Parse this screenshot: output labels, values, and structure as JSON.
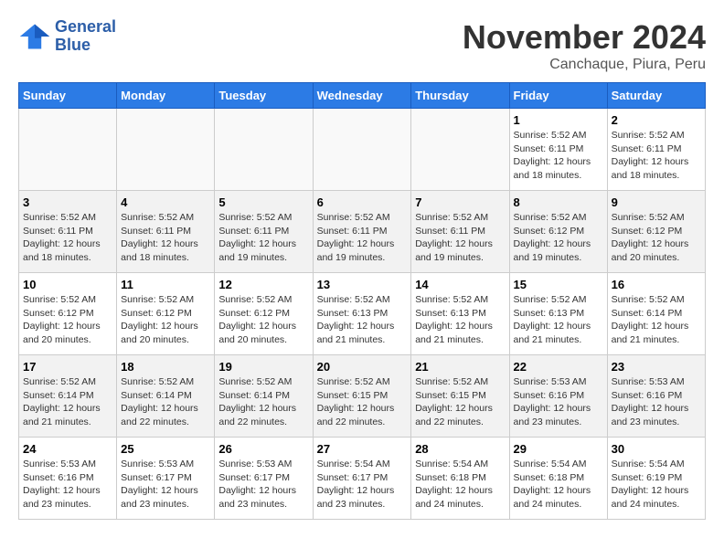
{
  "header": {
    "logo_line1": "General",
    "logo_line2": "Blue",
    "month": "November 2024",
    "location": "Canchaque, Piura, Peru"
  },
  "days_of_week": [
    "Sunday",
    "Monday",
    "Tuesday",
    "Wednesday",
    "Thursday",
    "Friday",
    "Saturday"
  ],
  "weeks": [
    [
      {
        "day": "",
        "info": ""
      },
      {
        "day": "",
        "info": ""
      },
      {
        "day": "",
        "info": ""
      },
      {
        "day": "",
        "info": ""
      },
      {
        "day": "",
        "info": ""
      },
      {
        "day": "1",
        "info": "Sunrise: 5:52 AM\nSunset: 6:11 PM\nDaylight: 12 hours and 18 minutes."
      },
      {
        "day": "2",
        "info": "Sunrise: 5:52 AM\nSunset: 6:11 PM\nDaylight: 12 hours and 18 minutes."
      }
    ],
    [
      {
        "day": "3",
        "info": "Sunrise: 5:52 AM\nSunset: 6:11 PM\nDaylight: 12 hours and 18 minutes."
      },
      {
        "day": "4",
        "info": "Sunrise: 5:52 AM\nSunset: 6:11 PM\nDaylight: 12 hours and 18 minutes."
      },
      {
        "day": "5",
        "info": "Sunrise: 5:52 AM\nSunset: 6:11 PM\nDaylight: 12 hours and 19 minutes."
      },
      {
        "day": "6",
        "info": "Sunrise: 5:52 AM\nSunset: 6:11 PM\nDaylight: 12 hours and 19 minutes."
      },
      {
        "day": "7",
        "info": "Sunrise: 5:52 AM\nSunset: 6:11 PM\nDaylight: 12 hours and 19 minutes."
      },
      {
        "day": "8",
        "info": "Sunrise: 5:52 AM\nSunset: 6:12 PM\nDaylight: 12 hours and 19 minutes."
      },
      {
        "day": "9",
        "info": "Sunrise: 5:52 AM\nSunset: 6:12 PM\nDaylight: 12 hours and 20 minutes."
      }
    ],
    [
      {
        "day": "10",
        "info": "Sunrise: 5:52 AM\nSunset: 6:12 PM\nDaylight: 12 hours and 20 minutes."
      },
      {
        "day": "11",
        "info": "Sunrise: 5:52 AM\nSunset: 6:12 PM\nDaylight: 12 hours and 20 minutes."
      },
      {
        "day": "12",
        "info": "Sunrise: 5:52 AM\nSunset: 6:12 PM\nDaylight: 12 hours and 20 minutes."
      },
      {
        "day": "13",
        "info": "Sunrise: 5:52 AM\nSunset: 6:13 PM\nDaylight: 12 hours and 21 minutes."
      },
      {
        "day": "14",
        "info": "Sunrise: 5:52 AM\nSunset: 6:13 PM\nDaylight: 12 hours and 21 minutes."
      },
      {
        "day": "15",
        "info": "Sunrise: 5:52 AM\nSunset: 6:13 PM\nDaylight: 12 hours and 21 minutes."
      },
      {
        "day": "16",
        "info": "Sunrise: 5:52 AM\nSunset: 6:14 PM\nDaylight: 12 hours and 21 minutes."
      }
    ],
    [
      {
        "day": "17",
        "info": "Sunrise: 5:52 AM\nSunset: 6:14 PM\nDaylight: 12 hours and 21 minutes."
      },
      {
        "day": "18",
        "info": "Sunrise: 5:52 AM\nSunset: 6:14 PM\nDaylight: 12 hours and 22 minutes."
      },
      {
        "day": "19",
        "info": "Sunrise: 5:52 AM\nSunset: 6:14 PM\nDaylight: 12 hours and 22 minutes."
      },
      {
        "day": "20",
        "info": "Sunrise: 5:52 AM\nSunset: 6:15 PM\nDaylight: 12 hours and 22 minutes."
      },
      {
        "day": "21",
        "info": "Sunrise: 5:52 AM\nSunset: 6:15 PM\nDaylight: 12 hours and 22 minutes."
      },
      {
        "day": "22",
        "info": "Sunrise: 5:53 AM\nSunset: 6:16 PM\nDaylight: 12 hours and 23 minutes."
      },
      {
        "day": "23",
        "info": "Sunrise: 5:53 AM\nSunset: 6:16 PM\nDaylight: 12 hours and 23 minutes."
      }
    ],
    [
      {
        "day": "24",
        "info": "Sunrise: 5:53 AM\nSunset: 6:16 PM\nDaylight: 12 hours and 23 minutes."
      },
      {
        "day": "25",
        "info": "Sunrise: 5:53 AM\nSunset: 6:17 PM\nDaylight: 12 hours and 23 minutes."
      },
      {
        "day": "26",
        "info": "Sunrise: 5:53 AM\nSunset: 6:17 PM\nDaylight: 12 hours and 23 minutes."
      },
      {
        "day": "27",
        "info": "Sunrise: 5:54 AM\nSunset: 6:17 PM\nDaylight: 12 hours and 23 minutes."
      },
      {
        "day": "28",
        "info": "Sunrise: 5:54 AM\nSunset: 6:18 PM\nDaylight: 12 hours and 24 minutes."
      },
      {
        "day": "29",
        "info": "Sunrise: 5:54 AM\nSunset: 6:18 PM\nDaylight: 12 hours and 24 minutes."
      },
      {
        "day": "30",
        "info": "Sunrise: 5:54 AM\nSunset: 6:19 PM\nDaylight: 12 hours and 24 minutes."
      }
    ]
  ]
}
